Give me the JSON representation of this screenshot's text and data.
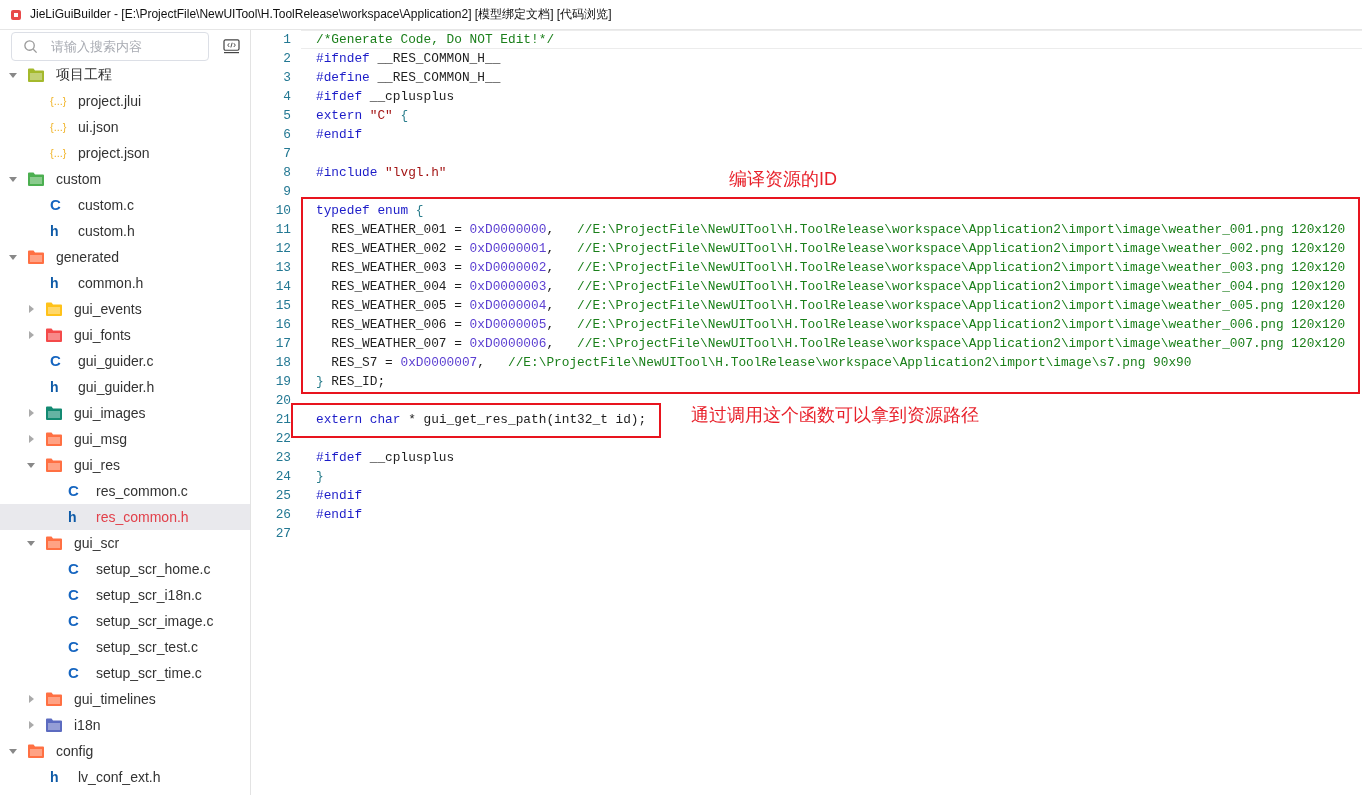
{
  "window": {
    "title": "JieLiGuiBuilder - [E:\\ProjectFile\\NewUITool\\H.ToolRelease\\workspace\\Application2] [模型绑定文档] [代码浏览]"
  },
  "sidebar": {
    "search": {
      "placeholder": "请输入搜索内容"
    },
    "tree": [
      {
        "kind": "folder",
        "label": "项目工程",
        "color": "#a4b92c",
        "expanded": true,
        "selected": false,
        "children": [
          {
            "kind": "json-file",
            "label": "project.jlui",
            "icon": "{...}",
            "selected": false
          },
          {
            "kind": "json-file",
            "label": "ui.json",
            "icon": "{...}",
            "selected": false
          },
          {
            "kind": "json-file",
            "label": "project.json",
            "icon": "{...}",
            "selected": false
          }
        ]
      },
      {
        "kind": "folder",
        "label": "custom",
        "color": "#4caf50",
        "expanded": true,
        "selected": false,
        "children": [
          {
            "kind": "c-file",
            "label": "custom.c",
            "icon": "C",
            "selected": false
          },
          {
            "kind": "h-file",
            "label": "custom.h",
            "icon": "h",
            "selected": false
          }
        ]
      },
      {
        "kind": "folder",
        "label": "generated",
        "color": "#ff7043",
        "expanded": true,
        "selected": false,
        "children": [
          {
            "kind": "h-file",
            "label": "common.h",
            "icon": "h",
            "selected": false
          },
          {
            "kind": "folder",
            "label": "gui_events",
            "color": "#ffc21a",
            "expanded": false,
            "selected": false
          },
          {
            "kind": "folder",
            "label": "gui_fonts",
            "color": "#f44a4a",
            "expanded": false,
            "selected": false
          },
          {
            "kind": "c-file",
            "label": "gui_guider.c",
            "icon": "C",
            "selected": false
          },
          {
            "kind": "h-file",
            "label": "gui_guider.h",
            "icon": "h",
            "selected": false
          },
          {
            "kind": "folder",
            "label": "gui_images",
            "color": "#138a72",
            "expanded": false,
            "selected": false
          },
          {
            "kind": "folder",
            "label": "gui_msg",
            "color": "#ff7043",
            "expanded": false,
            "selected": false
          },
          {
            "kind": "folder",
            "label": "gui_res",
            "color": "#ff7043",
            "expanded": true,
            "selected": false,
            "children": [
              {
                "kind": "c-file",
                "label": "res_common.c",
                "icon": "C",
                "selected": false
              },
              {
                "kind": "h-file",
                "label": "res_common.h",
                "icon": "h",
                "selected": true
              }
            ]
          },
          {
            "kind": "folder",
            "label": "gui_scr",
            "color": "#ff7043",
            "expanded": true,
            "selected": false,
            "children": [
              {
                "kind": "c-file",
                "label": "setup_scr_home.c",
                "icon": "C",
                "selected": false
              },
              {
                "kind": "c-file",
                "label": "setup_scr_i18n.c",
                "icon": "C",
                "selected": false
              },
              {
                "kind": "c-file",
                "label": "setup_scr_image.c",
                "icon": "C",
                "selected": false
              },
              {
                "kind": "c-file",
                "label": "setup_scr_test.c",
                "icon": "C",
                "selected": false
              },
              {
                "kind": "c-file",
                "label": "setup_scr_time.c",
                "icon": "C",
                "selected": false
              }
            ]
          },
          {
            "kind": "folder",
            "label": "gui_timelines",
            "color": "#ff7043",
            "expanded": false,
            "selected": false
          },
          {
            "kind": "folder",
            "label": "i18n",
            "color": "#5c6bc0",
            "expanded": false,
            "selected": false
          }
        ]
      },
      {
        "kind": "folder",
        "label": "config",
        "color": "#ff7043",
        "expanded": true,
        "selected": false,
        "children": [
          {
            "kind": "h-file",
            "label": "lv_conf_ext.h",
            "icon": "h",
            "selected": false
          }
        ]
      }
    ]
  },
  "editor": {
    "blocks": [
      {
        "framed": false,
        "lines": [
          {
            "number": "1",
            "current": true,
            "tokens": [
              {
                "kind": "comment",
                "text": "/*Generate Code, Do NOT Edit!*/"
              }
            ]
          },
          {
            "number": "2",
            "current": false,
            "tokens": [
              {
                "kind": "keyword",
                "text": "#ifndef"
              },
              {
                "kind": "plain",
                "text": " __RES_COMMON_H__"
              }
            ]
          },
          {
            "number": "3",
            "current": false,
            "tokens": [
              {
                "kind": "keyword",
                "text": "#define"
              },
              {
                "kind": "plain",
                "text": " __RES_COMMON_H__"
              }
            ]
          },
          {
            "number": "4",
            "current": false,
            "tokens": [
              {
                "kind": "keyword",
                "text": "#ifdef"
              },
              {
                "kind": "plain",
                "text": " __cplusplus"
              }
            ]
          },
          {
            "number": "5",
            "current": false,
            "tokens": [
              {
                "kind": "keyword",
                "text": "extern"
              },
              {
                "kind": "string",
                "text": " \"C\""
              },
              {
                "kind": "brace",
                "text": " {"
              }
            ]
          },
          {
            "number": "6",
            "current": false,
            "tokens": [
              {
                "kind": "keyword",
                "text": "#endif"
              }
            ]
          },
          {
            "number": "7",
            "current": false
          },
          {
            "number": "8",
            "current": false,
            "tokens": [
              {
                "kind": "keyword",
                "text": "#include"
              },
              {
                "kind": "string",
                "text": " \"lvgl.h\""
              }
            ]
          },
          {
            "number": "9",
            "current": false
          }
        ]
      },
      {
        "framed": true,
        "full_width": true,
        "note": "编译资源的ID",
        "note_beside": false,
        "lines": [
          {
            "number": "10",
            "current": false,
            "tokens": [
              {
                "kind": "keyword",
                "text": "typedef"
              },
              {
                "kind": "keyword",
                "text": " enum"
              },
              {
                "kind": "brace",
                "text": " {"
              }
            ]
          },
          {
            "number": "11",
            "current": false,
            "tokens": [
              {
                "kind": "plain",
                "text": "  RES_WEATHER_001 = "
              },
              {
                "kind": "number",
                "text": "0xD0000000"
              },
              {
                "kind": "plain",
                "text": ","
              },
              {
                "kind": "comment",
                "text": "   //E:\\ProjectFile\\NewUITool\\H.ToolRelease\\workspace\\Application2\\import\\image\\weather_001.png 120x120"
              }
            ]
          },
          {
            "number": "12",
            "current": false,
            "tokens": [
              {
                "kind": "plain",
                "text": "  RES_WEATHER_002 = "
              },
              {
                "kind": "number",
                "text": "0xD0000001"
              },
              {
                "kind": "plain",
                "text": ","
              },
              {
                "kind": "comment",
                "text": "   //E:\\ProjectFile\\NewUITool\\H.ToolRelease\\workspace\\Application2\\import\\image\\weather_002.png 120x120"
              }
            ]
          },
          {
            "number": "13",
            "current": false,
            "tokens": [
              {
                "kind": "plain",
                "text": "  RES_WEATHER_003 = "
              },
              {
                "kind": "number",
                "text": "0xD0000002"
              },
              {
                "kind": "plain",
                "text": ","
              },
              {
                "kind": "comment",
                "text": "   //E:\\ProjectFile\\NewUITool\\H.ToolRelease\\workspace\\Application2\\import\\image\\weather_003.png 120x120"
              }
            ]
          },
          {
            "number": "14",
            "current": false,
            "tokens": [
              {
                "kind": "plain",
                "text": "  RES_WEATHER_004 = "
              },
              {
                "kind": "number",
                "text": "0xD0000003"
              },
              {
                "kind": "plain",
                "text": ","
              },
              {
                "kind": "comment",
                "text": "   //E:\\ProjectFile\\NewUITool\\H.ToolRelease\\workspace\\Application2\\import\\image\\weather_004.png 120x120"
              }
            ]
          },
          {
            "number": "15",
            "current": false,
            "tokens": [
              {
                "kind": "plain",
                "text": "  RES_WEATHER_005 = "
              },
              {
                "kind": "number",
                "text": "0xD0000004"
              },
              {
                "kind": "plain",
                "text": ","
              },
              {
                "kind": "comment",
                "text": "   //E:\\ProjectFile\\NewUITool\\H.ToolRelease\\workspace\\Application2\\import\\image\\weather_005.png 120x120"
              }
            ]
          },
          {
            "number": "16",
            "current": false,
            "tokens": [
              {
                "kind": "plain",
                "text": "  RES_WEATHER_006 = "
              },
              {
                "kind": "number",
                "text": "0xD0000005"
              },
              {
                "kind": "plain",
                "text": ","
              },
              {
                "kind": "comment",
                "text": "   //E:\\ProjectFile\\NewUITool\\H.ToolRelease\\workspace\\Application2\\import\\image\\weather_006.png 120x120"
              }
            ]
          },
          {
            "number": "17",
            "current": false,
            "tokens": [
              {
                "kind": "plain",
                "text": "  RES_WEATHER_007 = "
              },
              {
                "kind": "number",
                "text": "0xD0000006"
              },
              {
                "kind": "plain",
                "text": ","
              },
              {
                "kind": "comment",
                "text": "   //E:\\ProjectFile\\NewUITool\\H.ToolRelease\\workspace\\Application2\\import\\image\\weather_007.png 120x120"
              }
            ]
          },
          {
            "number": "18",
            "current": false,
            "tokens": [
              {
                "kind": "plain",
                "text": "  RES_S7 = "
              },
              {
                "kind": "number",
                "text": "0xD0000007"
              },
              {
                "kind": "plain",
                "text": ","
              },
              {
                "kind": "comment",
                "text": "   //E:\\ProjectFile\\NewUITool\\H.ToolRelease\\workspace\\Application2\\import\\image\\s7.png 90x90"
              }
            ]
          },
          {
            "number": "19",
            "current": false,
            "tokens": [
              {
                "kind": "brace",
                "text": "}"
              },
              {
                "kind": "plain",
                "text": " RES_ID;"
              }
            ]
          }
        ]
      },
      {
        "framed": false,
        "lines": [
          {
            "number": "20",
            "current": false
          }
        ]
      },
      {
        "framed": true,
        "full_width": false,
        "note": "通过调用这个函数可以拿到资源路径",
        "note_beside": true,
        "lines": [
          {
            "number": "21",
            "current": false,
            "tokens": [
              {
                "kind": "keyword",
                "text": "extern"
              },
              {
                "kind": "keyword",
                "text": " char"
              },
              {
                "kind": "plain",
                "text": " * gui_get_res_path(int32_t id);"
              }
            ]
          }
        ]
      },
      {
        "framed": false,
        "lines": [
          {
            "number": "22",
            "current": false
          },
          {
            "number": "23",
            "current": false,
            "tokens": [
              {
                "kind": "keyword",
                "text": "#ifdef"
              },
              {
                "kind": "plain",
                "text": " __cplusplus"
              }
            ]
          },
          {
            "number": "24",
            "current": false,
            "tokens": [
              {
                "kind": "brace",
                "text": "}"
              }
            ]
          },
          {
            "number": "25",
            "current": false,
            "tokens": [
              {
                "kind": "keyword",
                "text": "#endif"
              }
            ]
          },
          {
            "number": "26",
            "current": false,
            "tokens": [
              {
                "kind": "keyword",
                "text": "#endif"
              }
            ]
          },
          {
            "number": "27",
            "current": false
          }
        ]
      }
    ]
  }
}
